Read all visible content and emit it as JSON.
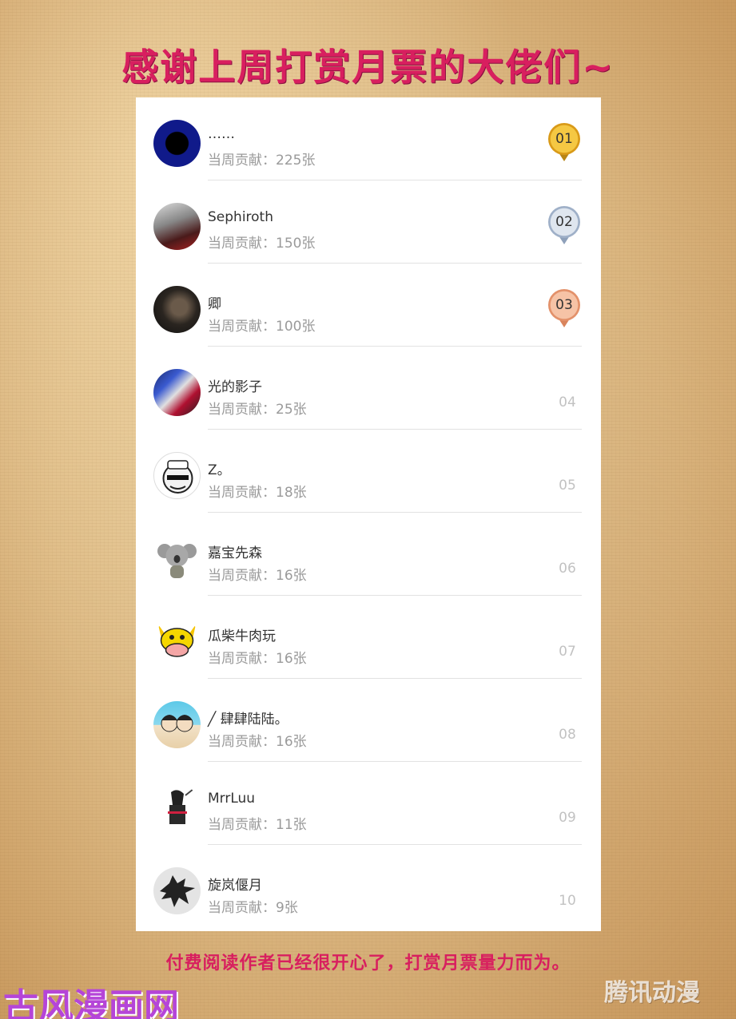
{
  "title": "感谢上周打赏月票的大佬们~",
  "contribution_prefix": "当周贡献：",
  "colors": {
    "title": "#d81f5f",
    "gold": "#e9b12b",
    "silver": "#b8c4d6",
    "bronze": "#e8a27f"
  },
  "ranking": [
    {
      "rank": "01",
      "name": "……",
      "contribution": "当周贡献：225张",
      "medal": "gold",
      "avatar": "blue-circle-avatar"
    },
    {
      "rank": "02",
      "name": "Sephiroth",
      "contribution": "当周贡献：150张",
      "medal": "silver",
      "avatar": "warrior-avatar"
    },
    {
      "rank": "03",
      "name": "卿",
      "contribution": "当周贡献：100张",
      "medal": "bronze",
      "avatar": "dark-portrait-avatar"
    },
    {
      "rank": "04",
      "name": "光的影子",
      "contribution": "当周贡献：25张",
      "medal": "",
      "avatar": "rider-avatar"
    },
    {
      "rank": "05",
      "name": "Z。",
      "contribution": "当周贡献：18张",
      "medal": "",
      "avatar": "meme-face-avatar"
    },
    {
      "rank": "06",
      "name": "嘉宝先森",
      "contribution": "当周贡献：16张",
      "medal": "",
      "avatar": "koala-avatar"
    },
    {
      "rank": "07",
      "name": "瓜柴牛肉玩",
      "contribution": "当周贡献：16张",
      "medal": "",
      "avatar": "cow-avatar"
    },
    {
      "rank": "08",
      "name": "╱ 肆肆陆陆。",
      "contribution": "当周贡献：16张",
      "medal": "",
      "avatar": "anime-pair-avatar"
    },
    {
      "rank": "09",
      "name": "MrrLuu",
      "contribution": "当周贡献：11张",
      "medal": "",
      "avatar": "sketch-avatar"
    },
    {
      "rank": "10",
      "name": "旋岚偃月",
      "contribution": "当周贡献：9张",
      "medal": "",
      "avatar": "wolf-avatar"
    }
  ],
  "footer": "付费阅读作者已经很开心了，打赏月票量力而为。",
  "watermark_left": "古风漫画网",
  "watermark_right": "腾讯动漫"
}
